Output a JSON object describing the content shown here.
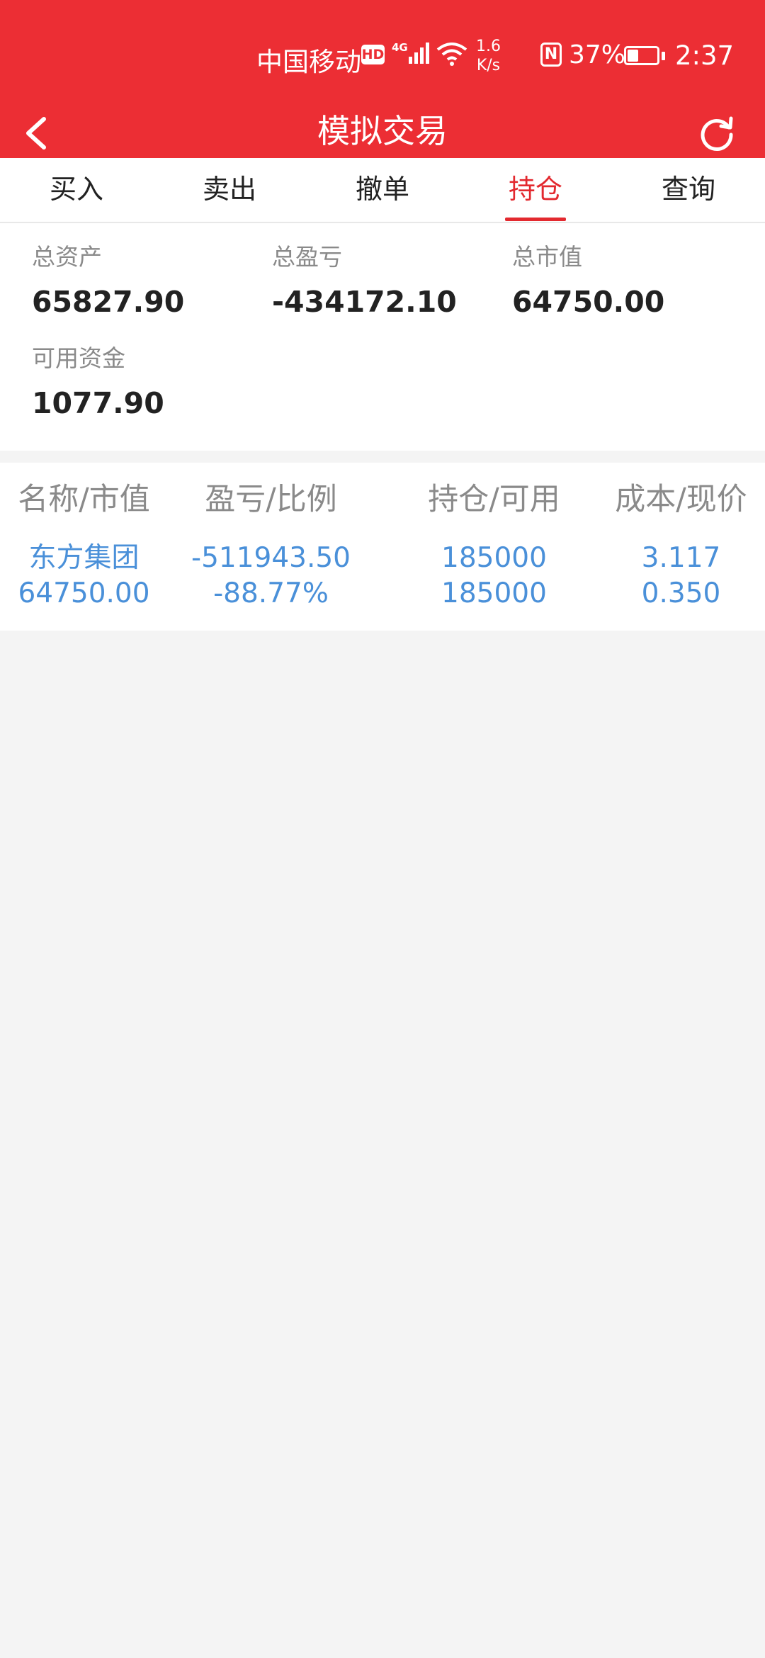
{
  "status_bar": {
    "carrier": "中国移动",
    "hd": "HD",
    "network": "4G",
    "speed_value": "1.6",
    "speed_unit": "K/s",
    "nfc": "N",
    "battery_percent": "37%",
    "time": "2:37"
  },
  "header": {
    "title": "模拟交易",
    "back_icon": "chevron-left-icon",
    "refresh_icon": "refresh-icon"
  },
  "tabs": [
    {
      "label": "买入",
      "active": false
    },
    {
      "label": "卖出",
      "active": false
    },
    {
      "label": "撤单",
      "active": false
    },
    {
      "label": "持仓",
      "active": true
    },
    {
      "label": "查询",
      "active": false
    }
  ],
  "summary": {
    "total_assets": {
      "label": "总资产",
      "value": "65827.90"
    },
    "total_pnl": {
      "label": "总盈亏",
      "value": "-434172.10"
    },
    "total_market_value": {
      "label": "总市值",
      "value": "64750.00"
    },
    "available_funds": {
      "label": "可用资金",
      "value": "1077.90"
    }
  },
  "holdings": {
    "headers": [
      "名称/市值",
      "盈亏/比例",
      "持仓/可用",
      "成本/现价"
    ],
    "rows": [
      {
        "name": "东方集团",
        "market_value": "64750.00",
        "pnl": "-511943.50",
        "pnl_ratio": "-88.77%",
        "position": "185000",
        "available": "185000",
        "cost": "3.117",
        "price": "0.350"
      }
    ]
  },
  "colors": {
    "header_bg": "#ec2e34",
    "active_tab": "#e3292f",
    "row_text": "#4a90d9",
    "label_gray": "#8a8a8a",
    "page_bg": "#f4f4f4"
  }
}
